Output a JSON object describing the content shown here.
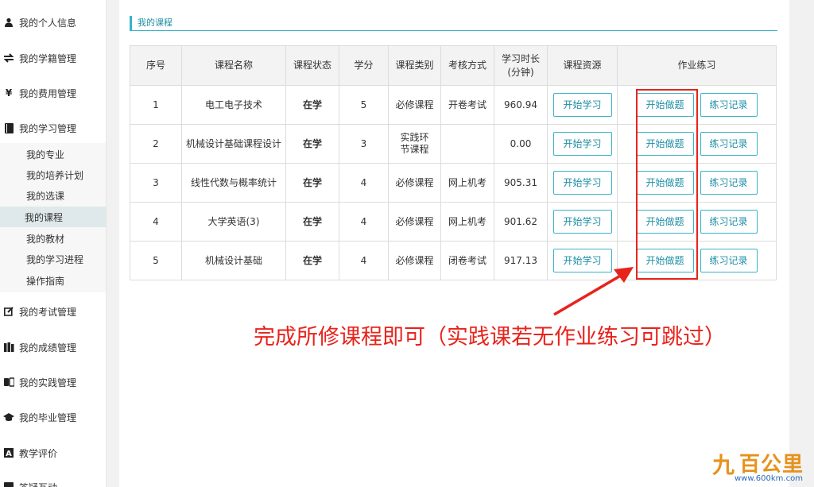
{
  "sidebar": {
    "items": [
      {
        "label": "我的个人信息",
        "icon": "user-icon",
        "glyph": "👤"
      },
      {
        "label": "我的学籍管理",
        "icon": "transfer-icon",
        "glyph": "⇄"
      },
      {
        "label": "我的费用管理",
        "icon": "yen-icon",
        "glyph": "¥"
      },
      {
        "label": "我的学习管理",
        "icon": "book-icon",
        "glyph": "▮"
      },
      {
        "label": "我的考试管理",
        "icon": "edit-icon",
        "glyph": "✎"
      },
      {
        "label": "我的成绩管理",
        "icon": "books-icon",
        "glyph": "▥"
      },
      {
        "label": "我的实践管理",
        "icon": "exchange-icon",
        "glyph": "⇆"
      },
      {
        "label": "我的毕业管理",
        "icon": "graduation-cap-icon",
        "glyph": "🎓"
      },
      {
        "label": "教学评价",
        "icon": "font-icon",
        "glyph": "A"
      },
      {
        "label": "答疑互动",
        "icon": "chat-icon",
        "glyph": "▭"
      }
    ],
    "sub_items": [
      "我的专业",
      "我的培养计划",
      "我的选课",
      "我的课程",
      "我的教材",
      "我的学习进程",
      "操作指南"
    ]
  },
  "panel": {
    "title": "我的课程"
  },
  "table": {
    "headers": {
      "index": "序号",
      "name": "课程名称",
      "status": "课程状态",
      "credit": "学分",
      "category": "课程类别",
      "exam": "考核方式",
      "hours_line1": "学习时长",
      "hours_line2": "(分钟)",
      "resource": "课程资源",
      "homework": "作业练习"
    },
    "rows": [
      {
        "index": "1",
        "name": "电工电子技术",
        "status": "在学",
        "credit": "5",
        "category": "必修课程",
        "exam": "开卷考试",
        "hours": "960.94"
      },
      {
        "index": "2",
        "name": "机械设计基础课程设计",
        "status": "在学",
        "credit": "3",
        "category": "实践环节课程",
        "exam": "",
        "hours": "0.00"
      },
      {
        "index": "3",
        "name": "线性代数与概率统计",
        "status": "在学",
        "credit": "4",
        "category": "必修课程",
        "exam": "网上机考",
        "hours": "905.31"
      },
      {
        "index": "4",
        "name": "大学英语(3)",
        "status": "在学",
        "credit": "4",
        "category": "必修课程",
        "exam": "网上机考",
        "hours": "901.62"
      },
      {
        "index": "5",
        "name": "机械设计基础",
        "status": "在学",
        "credit": "4",
        "category": "必修课程",
        "exam": "闭卷考试",
        "hours": "917.13"
      }
    ],
    "buttons": {
      "study": "开始学习",
      "do": "开始做题",
      "record": "练习记录"
    }
  },
  "annotation": {
    "note": "完成所修课程即可（实践课若无作业练习可跳过）",
    "color": "#e8231c"
  },
  "watermark": {
    "mark": "九",
    "text": "百公里",
    "url": "www.600km.com"
  }
}
